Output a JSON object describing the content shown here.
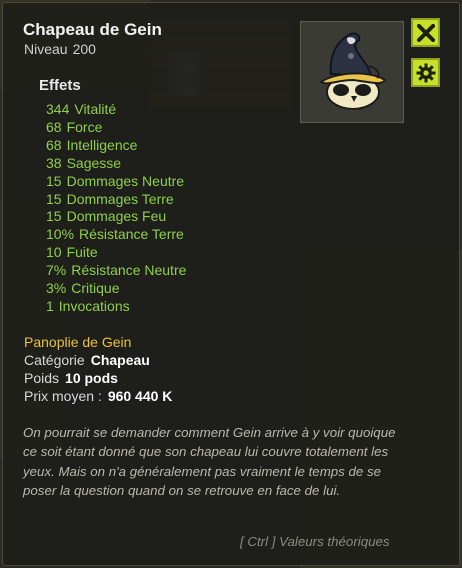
{
  "item": {
    "name": "Chapeau de Gein",
    "level_label": "Niveau",
    "level_value": "200"
  },
  "buttons": {
    "close_icon": "close-x-icon",
    "settings_icon": "gear-icon"
  },
  "effects_title": "Effets",
  "effects": [
    {
      "value": "344",
      "label": "Vitalité"
    },
    {
      "value": "68",
      "label": "Force"
    },
    {
      "value": "68",
      "label": "Intelligence"
    },
    {
      "value": "38",
      "label": "Sagesse"
    },
    {
      "value": "15",
      "label": "Dommages Neutre"
    },
    {
      "value": "15",
      "label": "Dommages Terre"
    },
    {
      "value": "15",
      "label": "Dommages Feu"
    },
    {
      "value": "10%",
      "label": "Résistance Terre"
    },
    {
      "value": "10",
      "label": "Fuite"
    },
    {
      "value": "7%",
      "label": "Résistance Neutre"
    },
    {
      "value": "3%",
      "label": "Critique"
    },
    {
      "value": "1",
      "label": "Invocations"
    }
  ],
  "set_name": "Panoplie de Gein",
  "properties": {
    "category_label": "Catégorie",
    "category_value": "Chapeau",
    "weight_label": "Poids",
    "weight_value": "10 pods",
    "price_label": "Prix moyen :",
    "price_value": "960 440 K"
  },
  "description": "On pourrait se demander comment Gein arrive à y voir quoique ce soit étant donné que son chapeau lui couvre totalement les yeux. Mais on n'a généralement pas vraiment le temps de se poser la question quand on se retrouve en face de lui.",
  "footer_hint": "[ Ctrl ] Valeurs théoriques",
  "colors": {
    "effect_green": "#8ed04a",
    "set_gold": "#e9c23a",
    "button_lime": "#c8e02a"
  }
}
